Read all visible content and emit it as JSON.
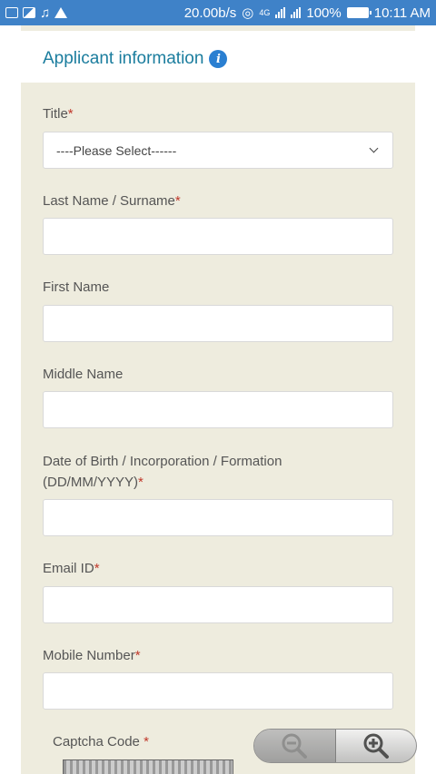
{
  "status_bar": {
    "speed": "20.00b/s",
    "network": "4G",
    "battery": "100%",
    "time": "10:11 AM"
  },
  "section": {
    "title": "Applicant information"
  },
  "form": {
    "title_label": "Title",
    "title_select_value": "----Please Select------",
    "last_name_label": "Last Name / Surname",
    "first_name_label": "First Name",
    "middle_name_label": "Middle Name",
    "dob_label_line1": "Date of Birth / Incorporation / Formation",
    "dob_label_line2": "(DD/MM/YYYY)",
    "email_label": "Email ID",
    "mobile_label": "Mobile Number",
    "captcha_label": "Captcha Code",
    "required_marker": "*"
  }
}
